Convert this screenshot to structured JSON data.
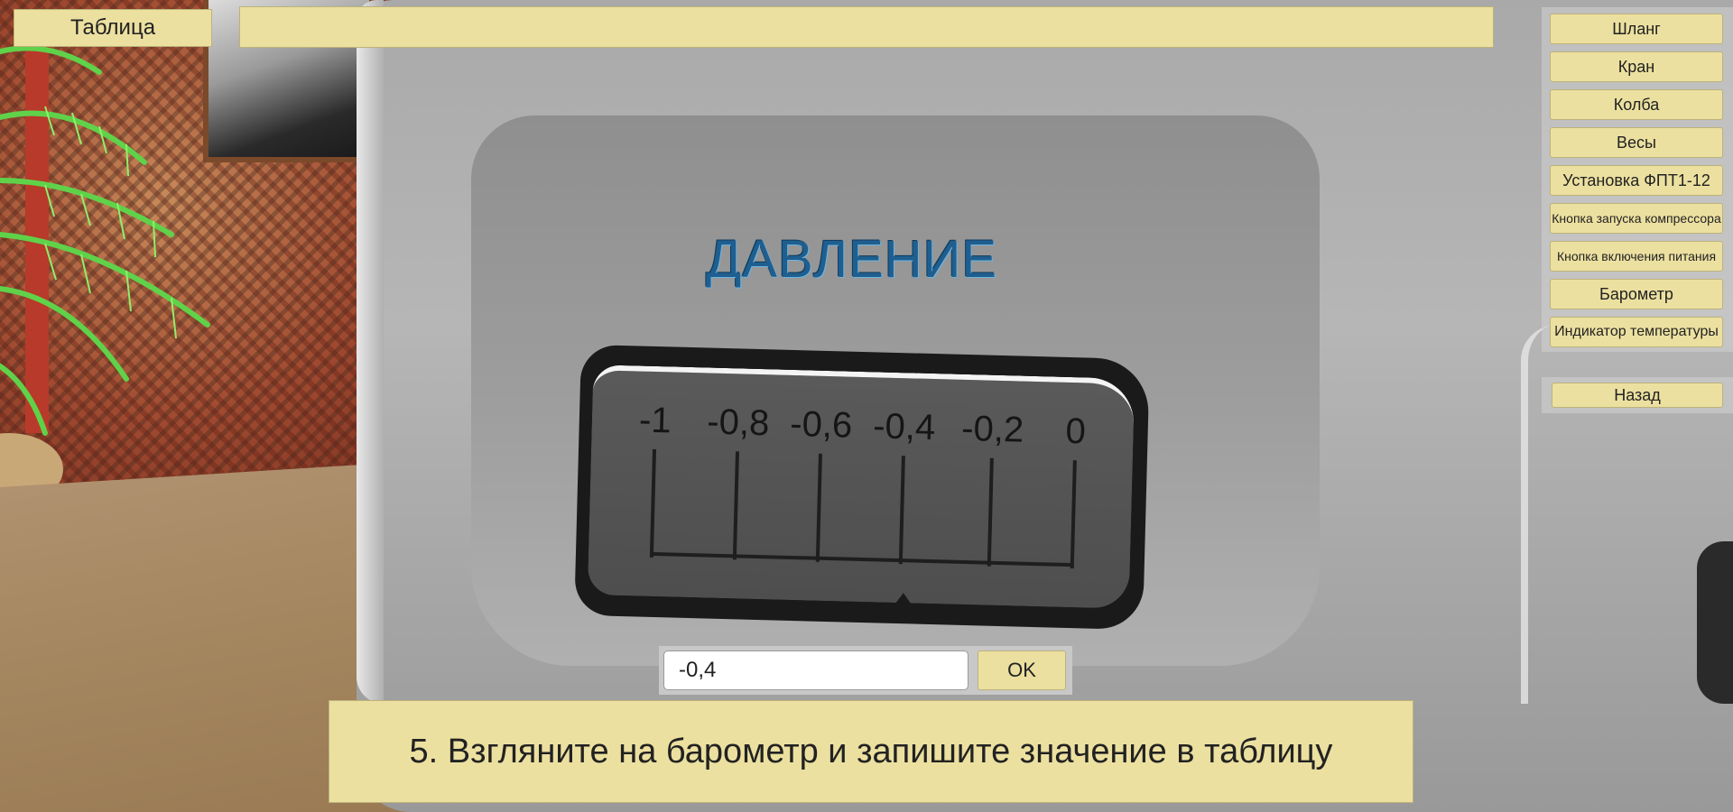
{
  "top_bar": {
    "table_button_label": "Таблица"
  },
  "device": {
    "title": "ДАВЛЕНИЕ"
  },
  "gauge": {
    "scale_labels": [
      "-1",
      "-0,8",
      "-0,6",
      "-0,4",
      "-0,2",
      "0"
    ]
  },
  "side_menu": {
    "items": [
      {
        "label": "Шланг"
      },
      {
        "label": "Кран"
      },
      {
        "label": "Колба"
      },
      {
        "label": "Весы"
      },
      {
        "label": "Установка ФПТ1-12"
      },
      {
        "label": "Кнопка запуска компрессора"
      },
      {
        "label": "Кнопка включения питания"
      },
      {
        "label": "Барометр"
      },
      {
        "label": "Индикатор температуры"
      }
    ],
    "back_label": "Назад"
  },
  "answer": {
    "value": "-0,4",
    "ok_label": "OK"
  },
  "instruction": {
    "text": "5. Взгляните на барометр и запишите значение в таблицу"
  },
  "colors": {
    "button_bg": "#ece0a0",
    "title_color": "#1f5f8f"
  }
}
